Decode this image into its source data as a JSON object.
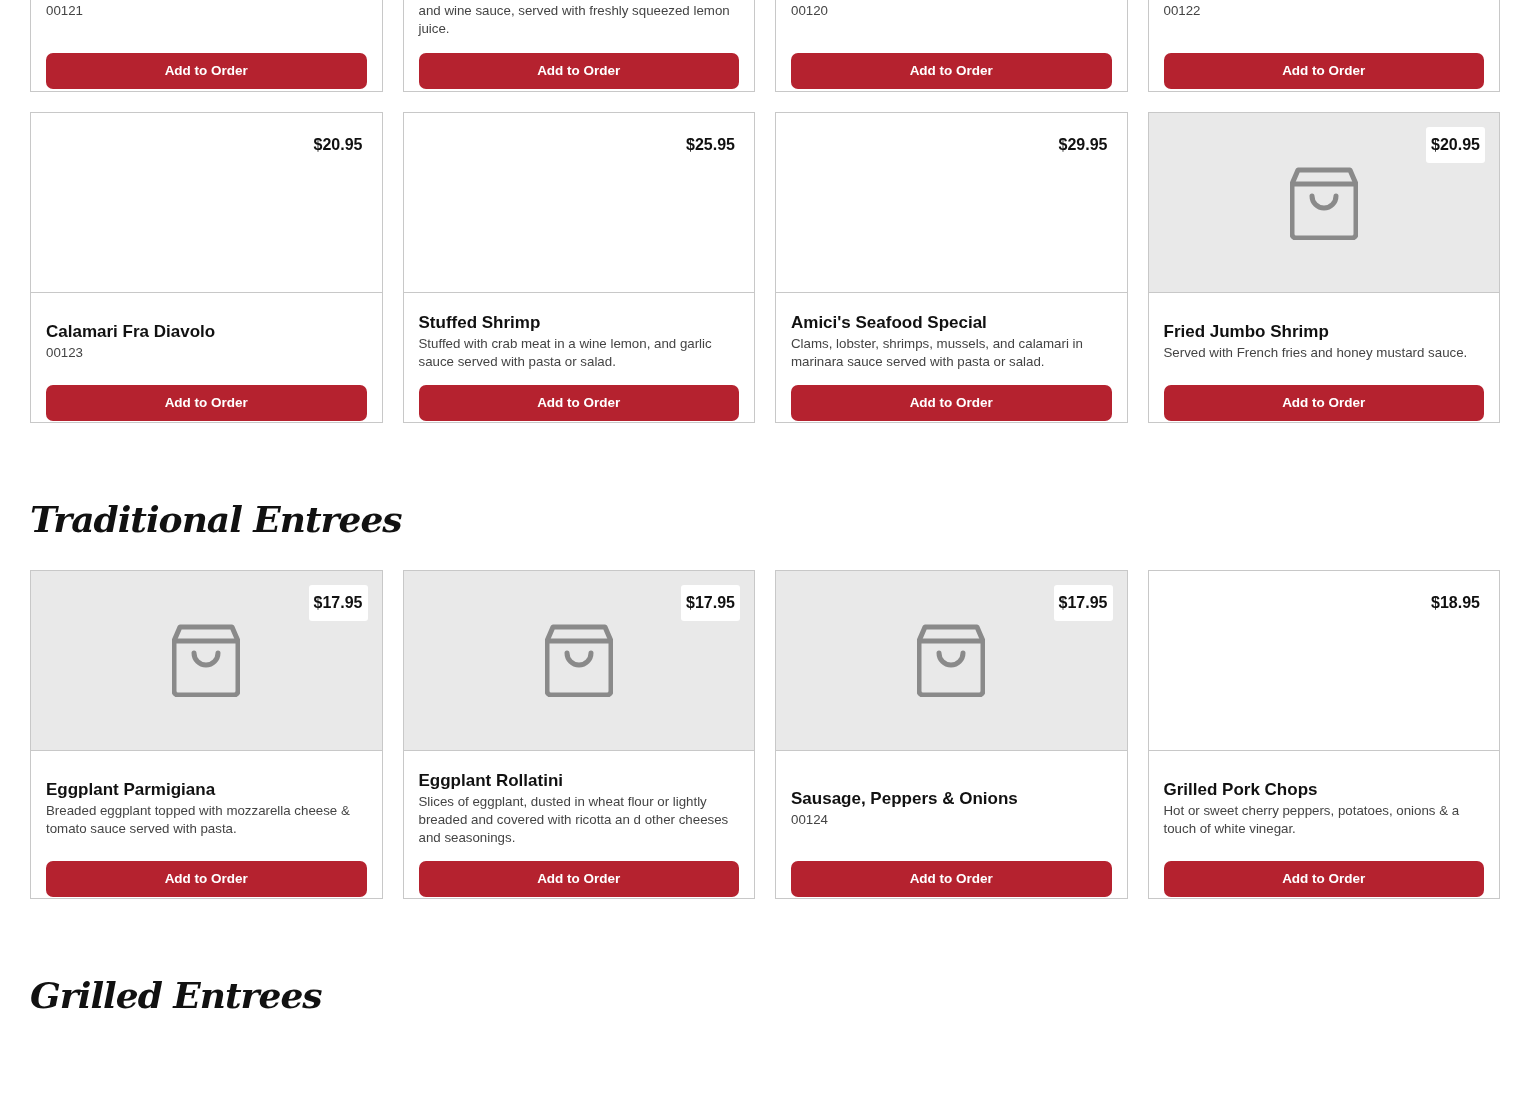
{
  "top_items": [
    {
      "text": "00121",
      "button": "Add to Order"
    },
    {
      "text": "and wine sauce, served with freshly squeezed lemon juice.",
      "button": "Add to Order"
    },
    {
      "text": "00120",
      "button": "Add to Order"
    },
    {
      "text": "00122",
      "button": "Add to Order"
    }
  ],
  "sections": [
    {
      "items": [
        {
          "price": "$20.95",
          "placeholder": false,
          "title": "Calamari Fra Diavolo",
          "text": "00123",
          "button": "Add to Order"
        },
        {
          "price": "$25.95",
          "placeholder": false,
          "title": "Stuffed Shrimp",
          "text": "Stuffed with crab meat in a wine lemon, and garlic sauce served with pasta or salad.",
          "button": "Add to Order"
        },
        {
          "price": "$29.95",
          "placeholder": false,
          "title": "Amici's Seafood Special",
          "text": "Clams, lobster, shrimps, mussels, and calamari in marinara sauce served with pasta or salad.",
          "button": "Add to Order"
        },
        {
          "price": "$20.95",
          "placeholder": true,
          "title": "Fried Jumbo Shrimp",
          "text": "Served with French fries and honey mustard sauce.",
          "button": "Add to Order"
        }
      ]
    },
    {
      "heading": "Traditional Entrees",
      "items": [
        {
          "price": "$17.95",
          "placeholder": true,
          "title": "Eggplant Parmigiana",
          "text": "Breaded eggplant topped with mozzarella cheese & tomato sauce served with pasta.",
          "button": "Add to Order"
        },
        {
          "price": "$17.95",
          "placeholder": true,
          "title": "Eggplant Rollatini",
          "text": "Slices of eggplant, dusted in wheat flour or lightly breaded and covered with ricotta an d other cheeses and seasonings.",
          "button": "Add to Order"
        },
        {
          "price": "$17.95",
          "placeholder": true,
          "title": "Sausage, Peppers & Onions",
          "text": "00124",
          "button": "Add to Order"
        },
        {
          "price": "$18.95",
          "placeholder": false,
          "title": "Grilled Pork Chops",
          "text": "Hot or sweet cherry peppers, potatoes, onions & a touch of white vinegar.",
          "button": "Add to Order"
        }
      ]
    },
    {
      "heading": "Grilled Entrees"
    }
  ]
}
